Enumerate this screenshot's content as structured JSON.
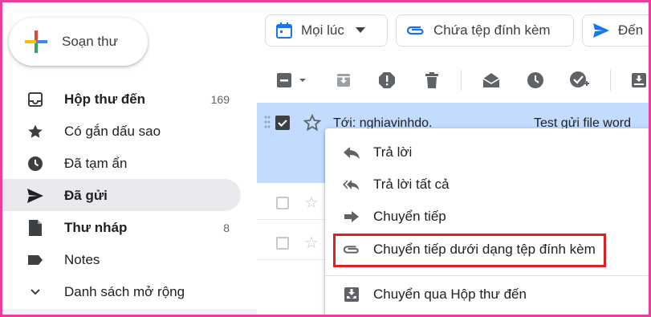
{
  "sidebar": {
    "compose_label": "Soạn thư",
    "items": [
      {
        "label": "Hộp thư đến",
        "count": "169",
        "icon": "inbox-icon"
      },
      {
        "label": "Có gắn dấu sao",
        "count": "",
        "icon": "star-icon"
      },
      {
        "label": "Đã tạm ẩn",
        "count": "",
        "icon": "clock-icon"
      },
      {
        "label": "Đã gửi",
        "count": "",
        "icon": "send-icon"
      },
      {
        "label": "Thư nháp",
        "count": "8",
        "icon": "draft-icon"
      },
      {
        "label": "Notes",
        "count": "",
        "icon": "label-icon"
      },
      {
        "label": "Danh sách mở rộng",
        "count": "",
        "icon": "chevron-down-icon"
      }
    ]
  },
  "filters": {
    "time_label": "Mọi lúc",
    "attachment_label": "Chứa tệp đính kèm",
    "to_label": "Đến"
  },
  "email": {
    "recipient": "Tới: nghiavinhdo.",
    "subject": "Test gửi file word"
  },
  "context_menu": {
    "items": [
      {
        "label": "Trả lời",
        "icon": "reply-icon"
      },
      {
        "label": "Trả lời tất cả",
        "icon": "reply-all-icon"
      },
      {
        "label": "Chuyển tiếp",
        "icon": "forward-icon"
      },
      {
        "label": "Chuyển tiếp dưới dạng tệp đính kèm",
        "icon": "attachment-icon"
      },
      {
        "label": "Chuyển qua Hộp thư đến",
        "icon": "move-to-inbox-icon"
      }
    ]
  },
  "colors": {
    "accent": "#1a73e8",
    "selected_row": "#c2dbff",
    "highlight_box": "#e02020",
    "frame": "#e83e9d"
  }
}
